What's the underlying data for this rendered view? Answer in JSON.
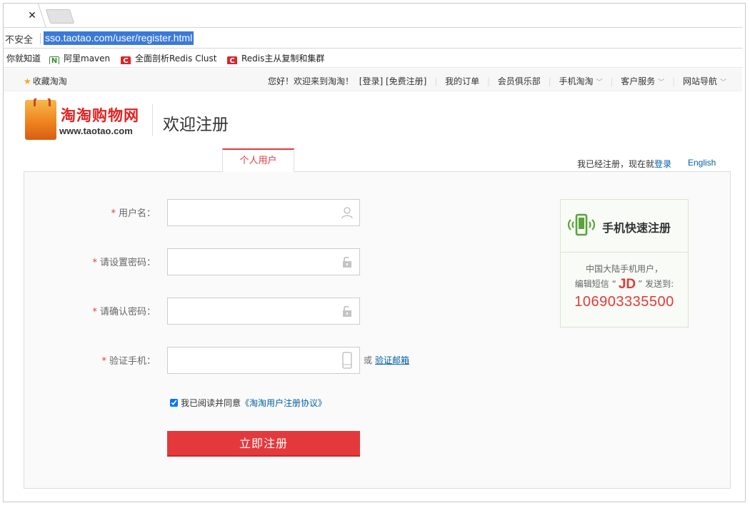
{
  "browser": {
    "tab_close_glyph": "✕",
    "security_label": "不安全",
    "url": "sso.taotao.com/user/register.html",
    "bookmarks": [
      {
        "label": "你就知道",
        "icon": "none"
      },
      {
        "label": "阿里maven",
        "icon": "n-icon"
      },
      {
        "label": "全面剖析Redis Clust",
        "icon": "c-icon"
      },
      {
        "label": "Redis主从复制和集群",
        "icon": "c-icon"
      }
    ]
  },
  "sitebar": {
    "favorite": "收藏淘淘",
    "greeting": "您好！欢迎来到淘淘！",
    "login": "[登录]",
    "register": "[免费注册]",
    "orders": "我的订单",
    "club": "会员俱乐部",
    "mobile": "手机淘淘",
    "service": "客户服务",
    "sitenav": "网站导航"
  },
  "header": {
    "logo_title": "淘淘购物网",
    "logo_sub": "www.taotao.com",
    "welcome": "欢迎注册"
  },
  "tabs": {
    "personal": "个人用户",
    "login_hint_prefix": "我已经注册，现在就",
    "login_link": "登录",
    "english": "English"
  },
  "form": {
    "required_mark": "*",
    "username_label": "用户名：",
    "password_label": "请设置密码：",
    "confirm_label": "请确认密码：",
    "phone_label": "验证手机：",
    "or_text": "或",
    "email_link": "验证邮箱",
    "agree_prefix": "我已阅读并同意",
    "agree_link": "《淘淘用户注册协议》",
    "agree_checked": true,
    "submit": "立即注册"
  },
  "mobile_box": {
    "title": "手机快速注册",
    "line1": "中国大陆手机用户，",
    "line2_prefix": "编辑短信 “",
    "code": "JD",
    "line2_suffix": "” 发送到:",
    "number": "106903335500"
  },
  "colors": {
    "accent": "#e4393c",
    "link": "#005ea7",
    "url_highlight": "#3b79d9",
    "mobile_icon": "#5aa53a"
  }
}
